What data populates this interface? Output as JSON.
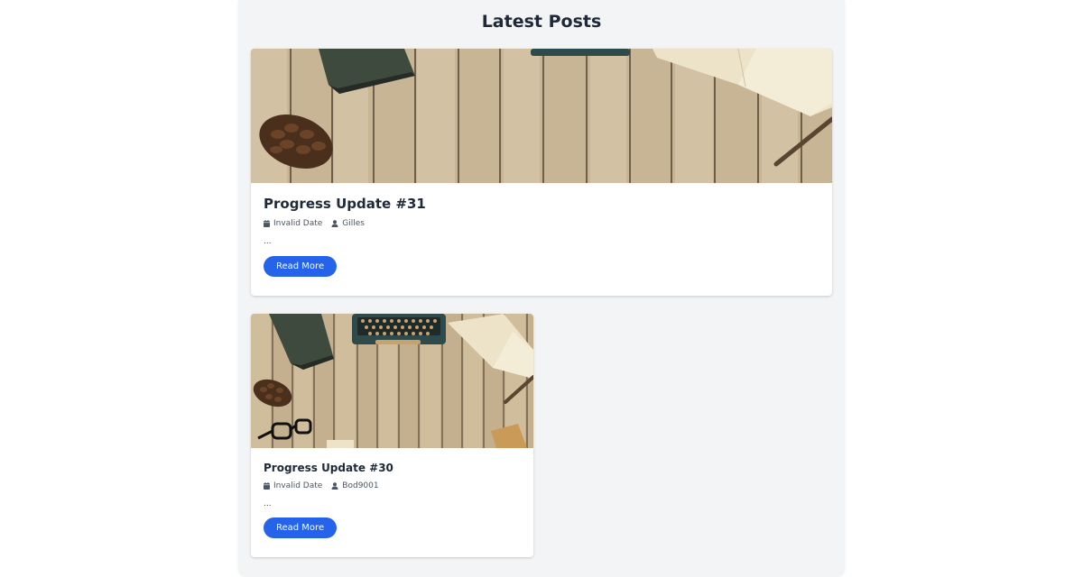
{
  "page": {
    "section_title": "Latest Posts"
  },
  "posts": [
    {
      "title": "Progress Update #31",
      "date": "Invalid Date",
      "author": "Gilles",
      "excerpt": "...",
      "cta": "Read More"
    },
    {
      "title": "Progress Update #30",
      "date": "Invalid Date",
      "author": "Bod9001",
      "excerpt": "...",
      "cta": "Read More"
    }
  ],
  "icons": {
    "date": "calendar-icon",
    "author": "user-icon"
  },
  "colors": {
    "accent": "#2563eb",
    "panel_bg": "#f3f4f6",
    "title_text": "#1f2937"
  }
}
